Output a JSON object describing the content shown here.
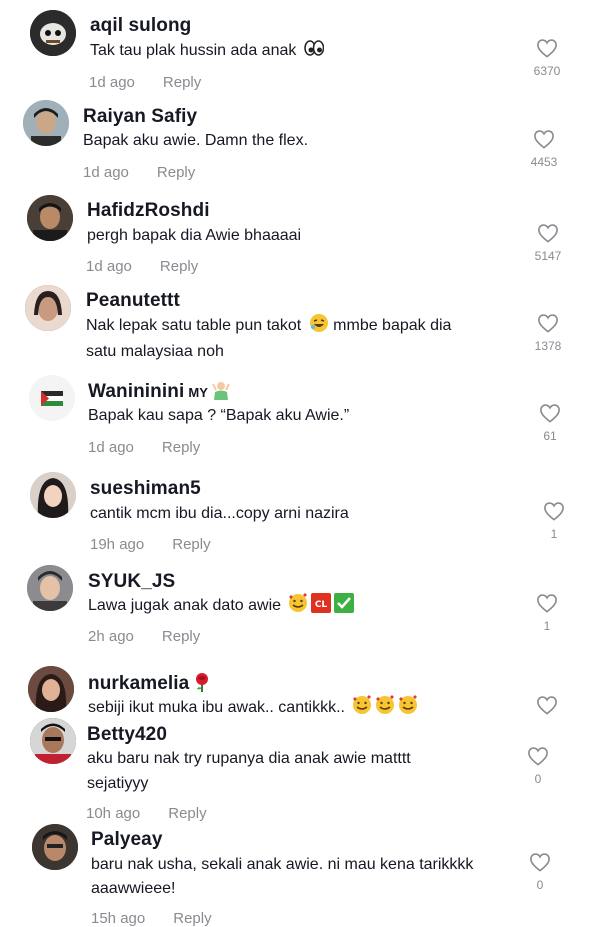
{
  "comments": [
    {
      "username": "aqil sulong",
      "text": "Tak tau plak hussin ada anak",
      "time": "1d ago",
      "reply": "Reply",
      "likes": "6370"
    },
    {
      "username": "Raiyan Safiy",
      "text": "Bapak aku awie. Damn the flex.",
      "time": "1d ago",
      "reply": "Reply",
      "likes": "4453"
    },
    {
      "username": "HafidzRoshdi",
      "text": "pergh bapak dia Awie bhaaaai",
      "time": "1d ago",
      "reply": "Reply",
      "likes": "5147"
    },
    {
      "username": "Peanutettt",
      "text": "Nak lepak satu table pun takot",
      "text_after": "mmbe bapak dia",
      "text2": "satu malaysiaa noh",
      "time": "",
      "reply": "",
      "likes": "1378"
    },
    {
      "username": "Wanininini",
      "badge": "MY",
      "text": "Bapak kau sapa ? “Bapak aku Awie.”",
      "time": "1d ago",
      "reply": "Reply",
      "likes": "61"
    },
    {
      "username": "sueshiman5",
      "text": "cantik mcm ibu dia...copy arni nazira",
      "time": "19h ago",
      "reply": "Reply",
      "likes": "1"
    },
    {
      "username": "SYUK_JS",
      "text": "Lawa jugak anak dato awie",
      "time": "2h ago",
      "reply": "Reply",
      "likes": "1"
    },
    {
      "username": "nurkamelia",
      "text": "sebiji ikut muka ibu awak.. cantikkk..",
      "time": "",
      "reply": "",
      "likes": ""
    },
    {
      "username": "Betty420",
      "text": "aku baru nak try rupanya dia anak awie matttt",
      "text2": "sejatiyyy",
      "time": "10h ago",
      "reply": "Reply",
      "likes": "0"
    },
    {
      "username": "Palyeay",
      "text": "baru nak usha, sekali anak awie. ni mau kena tarikkkk",
      "text2": "aaawwieee!",
      "time": "15h ago",
      "reply": "Reply",
      "likes": "0"
    }
  ],
  "emoji_cl": "CL",
  "colors": {
    "meta": "#8a8b91",
    "text": "#161823",
    "heart": "#8a8b91"
  }
}
